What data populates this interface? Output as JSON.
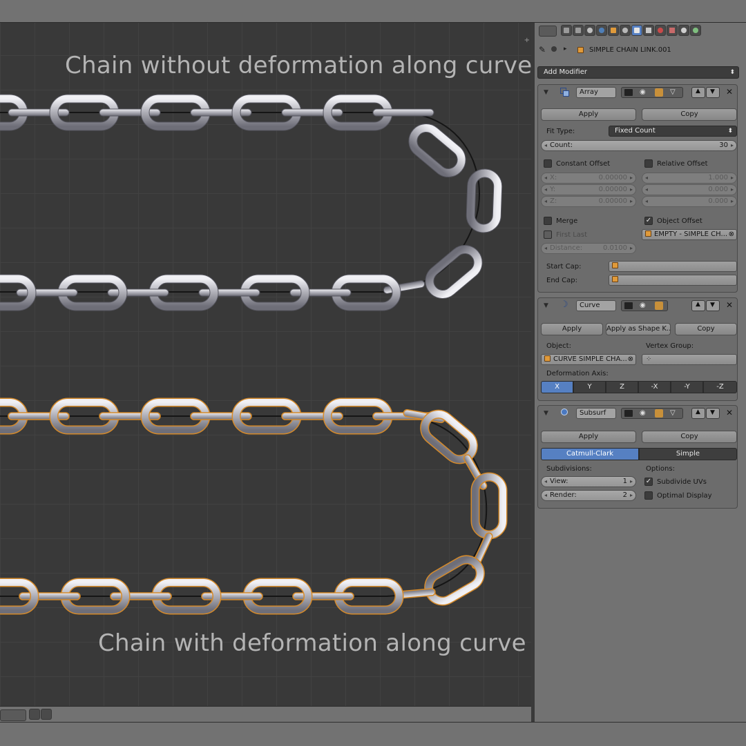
{
  "viewport": {
    "top_title": "Chain without deformation along curve",
    "bottom_title": "Chain with deformation along curve"
  },
  "properties": {
    "breadcrumb": {
      "object_name": "SIMPLE CHAIN LINK.001"
    },
    "add_modifier": "Add Modifier",
    "array": {
      "name": "Array",
      "apply": "Apply",
      "copy": "Copy",
      "fit_type_label": "Fit Type:",
      "fit_type_value": "Fixed Count",
      "count_label": "Count:",
      "count_value": "30",
      "constant_offset": "Constant Offset",
      "relative_offset": "Relative Offset",
      "const_x_label": "X:",
      "const_x": "0.00000",
      "const_y_label": "Y:",
      "const_y": "0.00000",
      "const_z_label": "Z:",
      "const_z": "0.00000",
      "rel_x": "1.000",
      "rel_y": "0.000",
      "rel_z": "0.000",
      "merge": "Merge",
      "object_offset": "Object Offset",
      "first_last": "First Last",
      "offset_object": "EMPTY - SIMPLE CH...",
      "distance_label": "Distance:",
      "distance_value": "0.0100",
      "start_cap": "Start Cap:",
      "end_cap": "End Cap:"
    },
    "curve": {
      "name": "Curve",
      "apply": "Apply",
      "apply_shape": "Apply as Shape K...",
      "copy": "Copy",
      "object_label": "Object:",
      "vertex_group_label": "Vertex Group:",
      "object_value": "CURVE SIMPLE CHA...",
      "deformation_axis": "Deformation Axis:",
      "axes": [
        "X",
        "Y",
        "Z",
        "-X",
        "-Y",
        "-Z"
      ],
      "active_axis": "X"
    },
    "subsurf": {
      "name": "Subsurf",
      "apply": "Apply",
      "copy": "Copy",
      "catmull": "Catmull-Clark",
      "simple": "Simple",
      "subdivisions": "Subdivisions:",
      "options": "Options:",
      "view_label": "View:",
      "view_value": "1",
      "render_label": "Render:",
      "render_value": "2",
      "subdivide_uvs": "Subdivide UVs",
      "optimal_display": "Optimal Display"
    }
  },
  "colors": {
    "accent": "#5680c2",
    "viewport_bg": "#393939",
    "chain_outline": "#d58a2a",
    "object_icon": "#e09a3a"
  },
  "icons": [
    "editor-type-icon",
    "render-icon",
    "render-layers-icon",
    "scene-icon",
    "world-icon",
    "object-icon",
    "constraints-icon",
    "modifier-icon",
    "data-icon",
    "material-icon",
    "texture-icon",
    "particles-icon",
    "physics-icon",
    "pin-icon",
    "camera-icon",
    "eye-icon",
    "edit-mode-icon",
    "cage-icon",
    "move-up-icon",
    "move-down-icon",
    "close-icon",
    "cube-icon"
  ]
}
